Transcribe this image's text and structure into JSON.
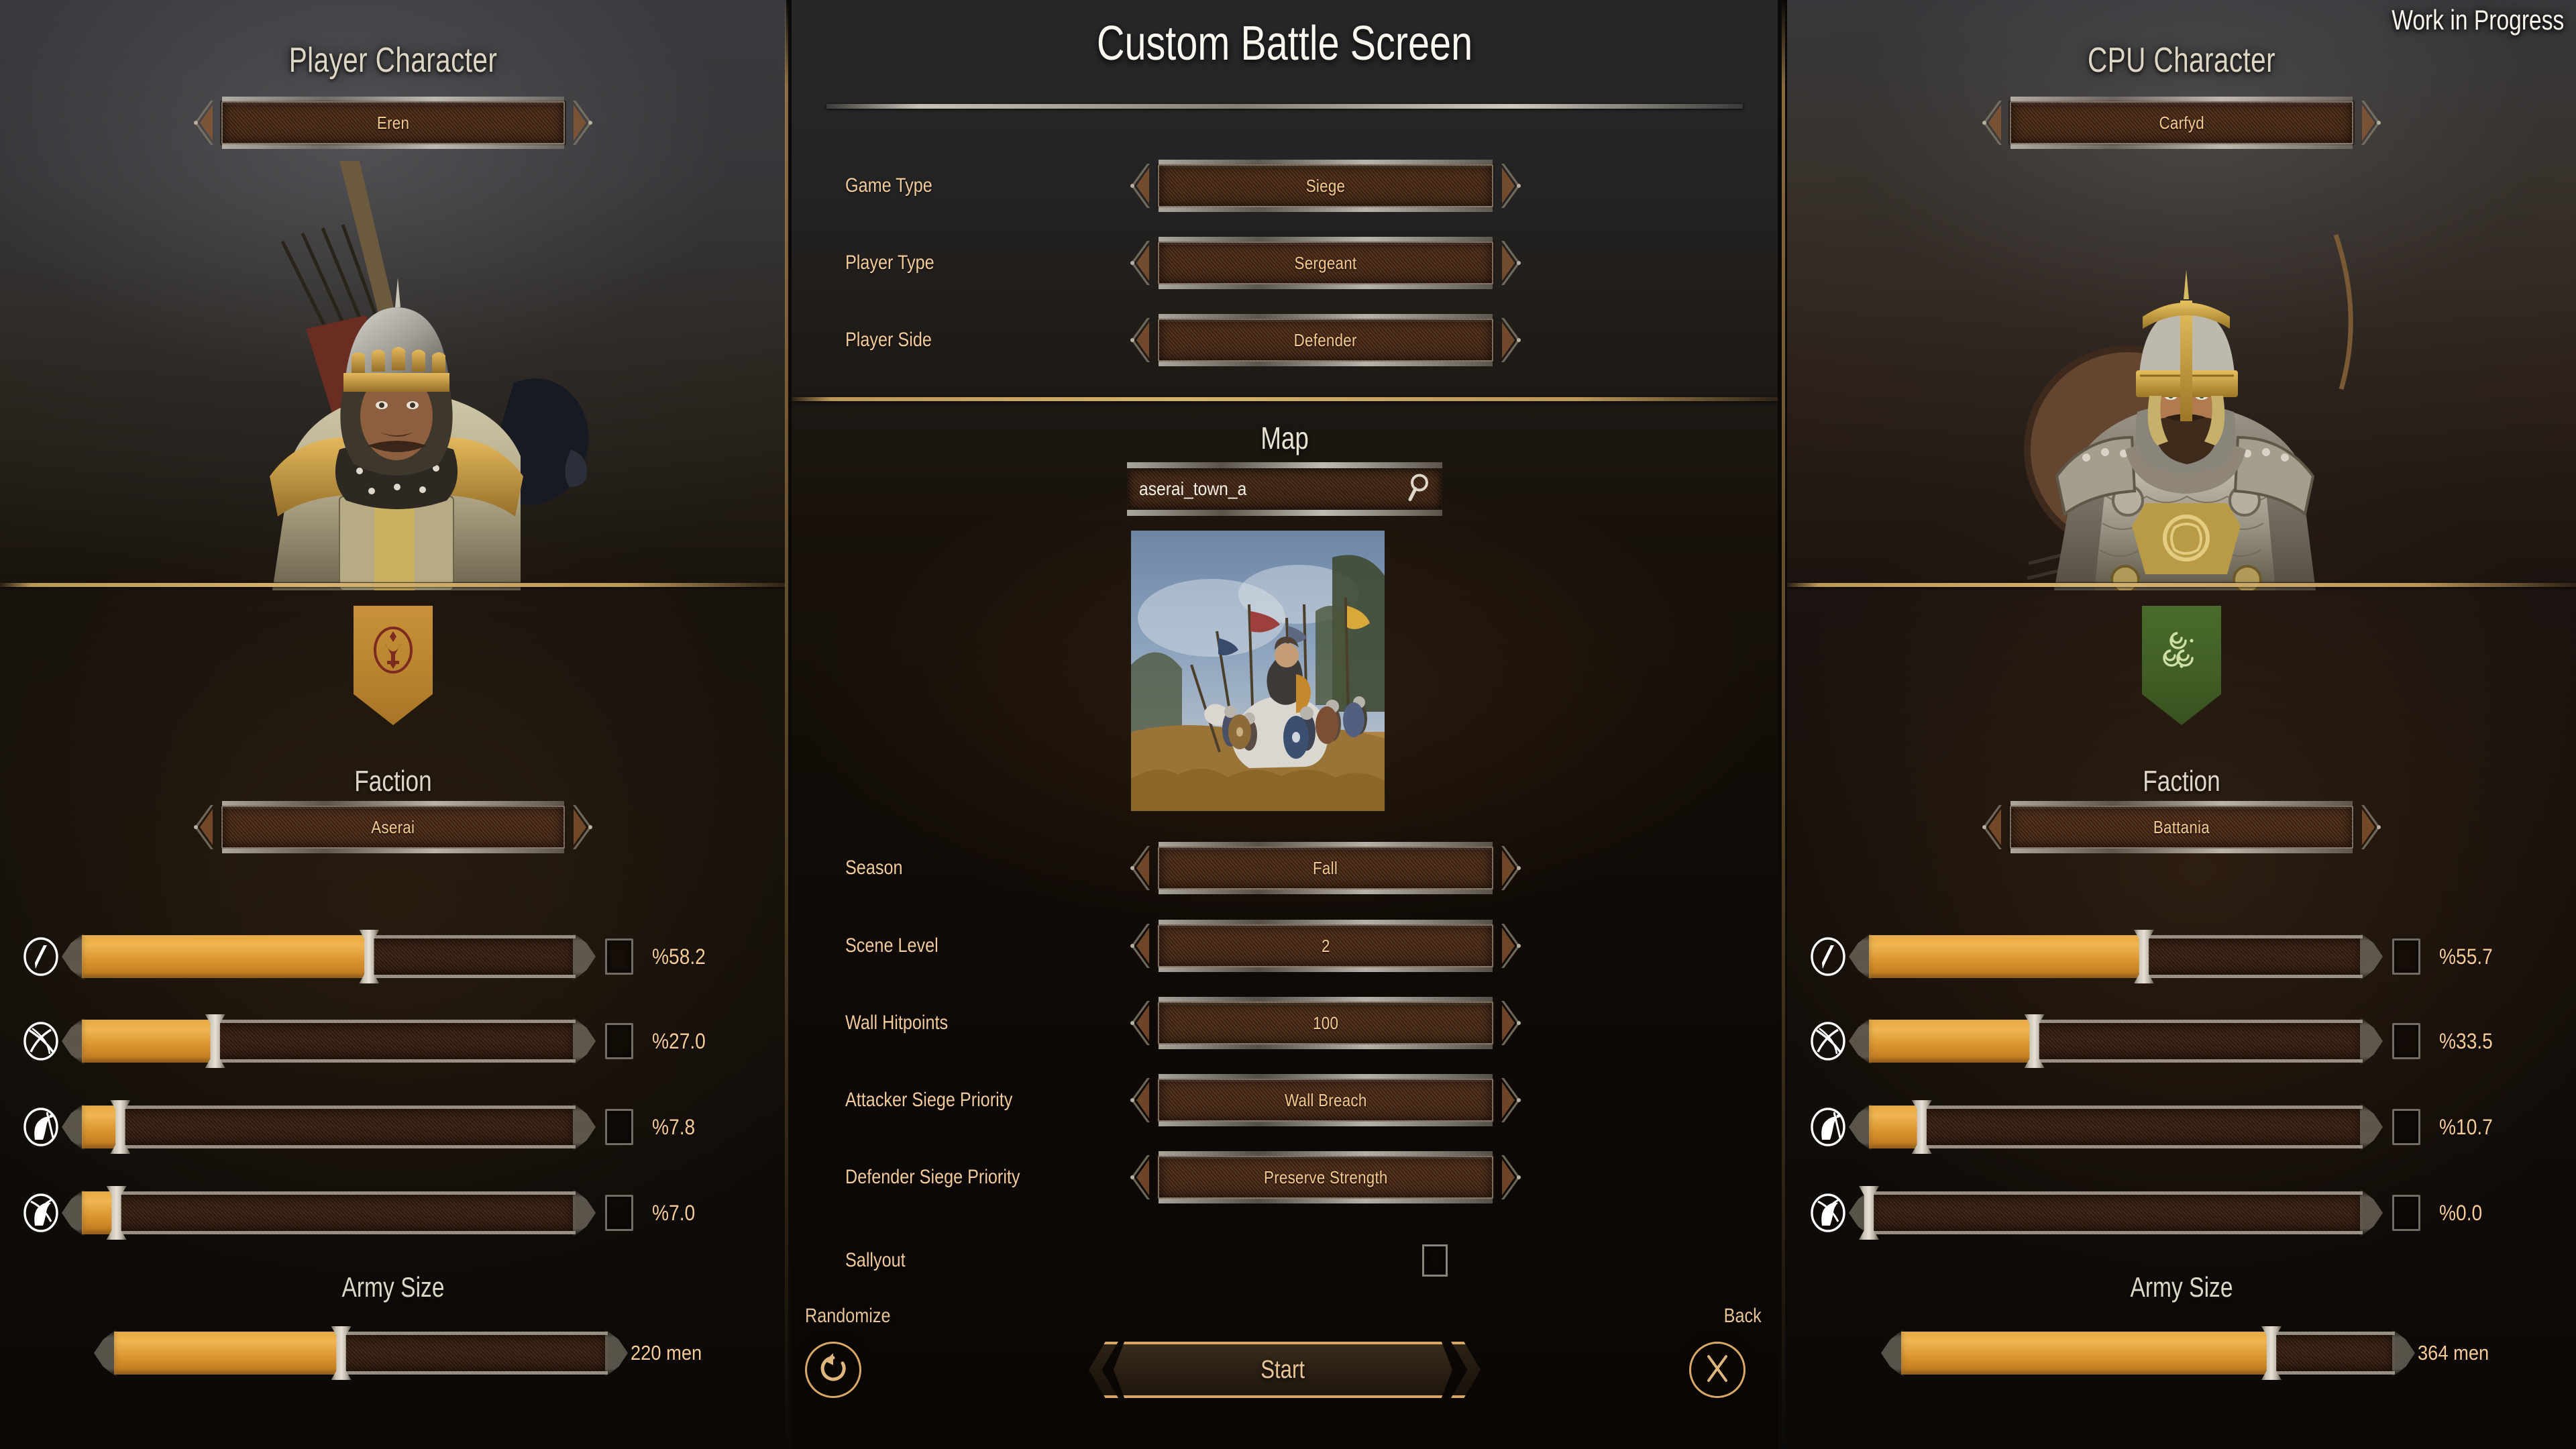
{
  "overlay": {
    "wip_text": "Work in Progress"
  },
  "left_panel": {
    "title": "Player Character",
    "character_name": "Eren",
    "faction_label": "Faction",
    "faction_name": "Aserai",
    "faction_banner_color": "#c0882f",
    "troops": [
      {
        "icon": "infantry-icon",
        "percent": "%58.2",
        "fill": 58.2
      },
      {
        "icon": "ranged-icon",
        "percent": "%27.0",
        "fill": 27.0
      },
      {
        "icon": "cavalry-icon",
        "percent": "%7.8",
        "fill": 7.8
      },
      {
        "icon": "horse-archer-icon",
        "percent": "%7.0",
        "fill": 7.0
      }
    ],
    "army_size_label": "Army Size",
    "army_size_value": "220 men",
    "army_size_fill": 46
  },
  "center_panel": {
    "title": "Custom Battle Screen",
    "config_rows": [
      {
        "label": "Game Type",
        "value": "Siege"
      },
      {
        "label": "Player Type",
        "value": "Sergeant"
      },
      {
        "label": "Player Side",
        "value": "Defender"
      }
    ],
    "map_heading": "Map",
    "map_search_value": "aserai_town_a",
    "map_search_icon": "search-icon",
    "map_rows": [
      {
        "label": "Season",
        "value": "Fall"
      },
      {
        "label": "Scene Level",
        "value": "2"
      },
      {
        "label": "Wall Hitpoints",
        "value": "100"
      },
      {
        "label": "Attacker Siege Priority",
        "value": "Wall Breach"
      },
      {
        "label": "Defender Siege Priority",
        "value": "Preserve Strength"
      }
    ],
    "sallyout_label": "Sallyout",
    "sallyout_checked": false,
    "randomize_label": "Randomize",
    "randomize_icon": "refresh-icon",
    "start_label": "Start",
    "back_label": "Back",
    "back_icon": "close-x-icon"
  },
  "right_panel": {
    "title": "CPU Character",
    "character_name": "Carfyd",
    "faction_label": "Faction",
    "faction_name": "Battania",
    "faction_banner_color": "#44632a",
    "troops": [
      {
        "icon": "infantry-icon",
        "percent": "%55.7",
        "fill": 55.7
      },
      {
        "icon": "ranged-icon",
        "percent": "%33.5",
        "fill": 33.5
      },
      {
        "icon": "cavalry-icon",
        "percent": "%10.7",
        "fill": 10.7
      },
      {
        "icon": "horse-archer-icon",
        "percent": "%0.0",
        "fill": 0.0
      }
    ],
    "army_size_label": "Army Size",
    "army_size_value": "364 men",
    "army_size_fill": 75
  },
  "accents": {
    "gold_divider": "#d6ab6a",
    "value_text": "#f6c98f",
    "heading_text": "#ded7c6",
    "slider_fill": "#e9a63c"
  }
}
